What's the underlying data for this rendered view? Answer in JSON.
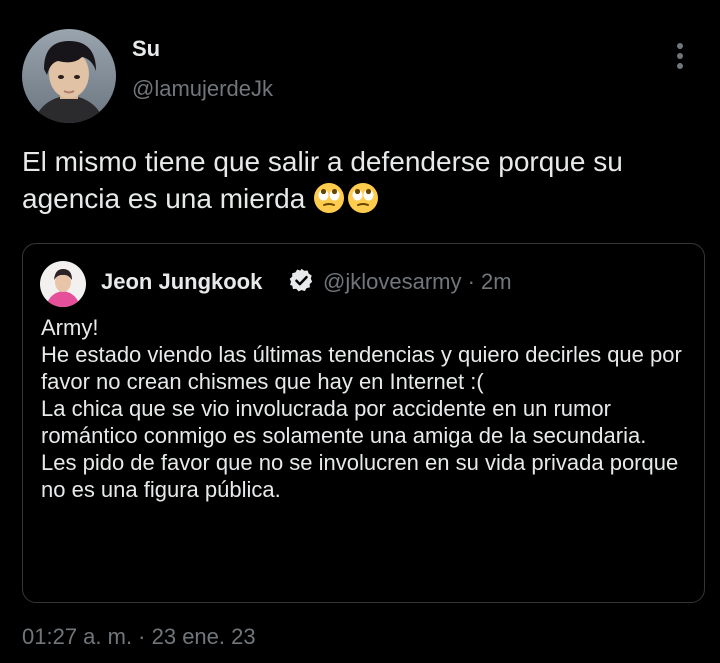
{
  "tweet": {
    "author_name": "Su",
    "author_handle": "@lamujerdeJk",
    "text": "El mismo tiene que salir a defenderse porque su agencia es una mierda",
    "emojis": [
      "face-with-rolling-eyes",
      "face-with-rolling-eyes"
    ],
    "timestamp": "01:27 a. m. · 23 ene. 23"
  },
  "quote": {
    "author_name": "Jeon Jungkook",
    "verified": true,
    "author_handle": "@jklovesarmy",
    "separator": "·",
    "time": "2m",
    "text": "Army!\nHe estado viendo las últimas tendencias y quiero decirles que por favor no crean chismes que hay en Internet :(\nLa chica que se vio involucrada por accidente en un rumor romántico conmigo es solamente una amiga de la secundaria.\nLes pido de favor que no se involucren en su vida privada porque no es una figura pública."
  },
  "colors": {
    "background": "#000000",
    "text": "#e7e9ea",
    "muted": "#71767b",
    "border": "#333639",
    "verified": "#e7e9ea"
  }
}
